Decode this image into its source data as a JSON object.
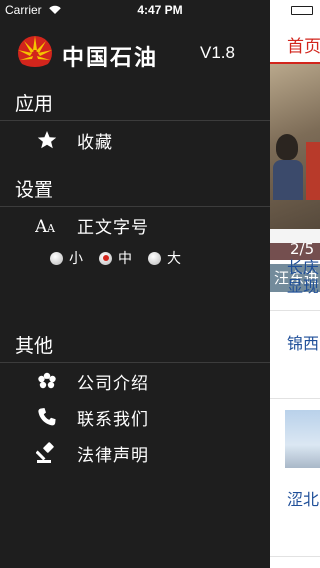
{
  "status_bar": {
    "carrier": "Carrier",
    "time": "4:47 PM"
  },
  "menu": {
    "app_name": "中国石油",
    "version": "V1.8",
    "sections": {
      "apps": {
        "title": "应用",
        "favorites": "收藏"
      },
      "settings": {
        "title": "设置",
        "font_size_label": "正文字号",
        "options": {
          "small": "小",
          "medium": "中",
          "large": "大"
        },
        "selected": "medium"
      },
      "other": {
        "title": "其他",
        "about": "公司介绍",
        "contact": "联系我们",
        "legal": "法律声明"
      }
    }
  },
  "content": {
    "tab": "首页",
    "slide_counter": "2/5",
    "slide_caption": "汪东进",
    "news": {
      "item1_line1": "长庆",
      "item1_line2": "显现",
      "item2": "锦西",
      "item3": "涩北"
    }
  },
  "colors": {
    "accent": "#d2251c",
    "menu_bg": "#1e1e1e",
    "link": "#1f4f99"
  }
}
